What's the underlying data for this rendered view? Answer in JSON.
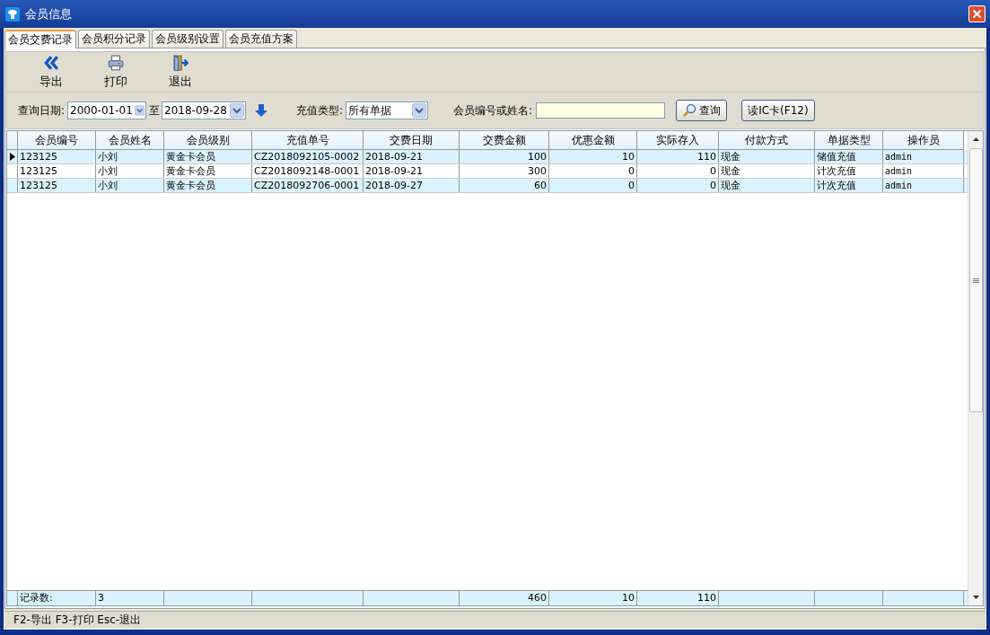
{
  "window": {
    "title": "会员信息"
  },
  "tabs": [
    {
      "label": "会员交费记录",
      "selected": true
    },
    {
      "label": "会员积分记录",
      "selected": false
    },
    {
      "label": "会员级别设置",
      "selected": false
    },
    {
      "label": "会员充值方案",
      "selected": false
    }
  ],
  "toolbar": [
    {
      "kind": "export",
      "label": "导出"
    },
    {
      "kind": "print",
      "label": "打印"
    },
    {
      "kind": "exit",
      "label": "退出"
    }
  ],
  "filters": {
    "date_label": "查询日期:",
    "date_from": "2000-01-01",
    "date_separator": "至",
    "date_to": "2018-09-28",
    "type_label": "充值类型:",
    "type_value": "所有单据",
    "member_label": "会员编号或姓名:",
    "search_button": "查询",
    "ic_button": "读IC卡(F12)"
  },
  "table": {
    "columns": [
      {
        "label": "会员编号",
        "kind": "text"
      },
      {
        "label": "会员姓名",
        "kind": "text"
      },
      {
        "label": "会员级别",
        "kind": "text"
      },
      {
        "label": "充值单号",
        "kind": "text"
      },
      {
        "label": "交费日期",
        "kind": "text"
      },
      {
        "label": "交费金额",
        "kind": "number"
      },
      {
        "label": "优惠金额",
        "kind": "number"
      },
      {
        "label": "实际存入",
        "kind": "number"
      },
      {
        "label": "付款方式",
        "kind": "text"
      },
      {
        "label": "单据类型",
        "kind": "text"
      },
      {
        "label": "操作员",
        "kind": "text"
      }
    ],
    "rows": [
      {
        "selected": true,
        "cells": [
          "123125",
          "小刘",
          "黄金卡会员",
          "CZ2018092105-0002",
          "2018-09-21",
          "100",
          "10",
          "110",
          "现金",
          "储值充值",
          "admin"
        ]
      },
      {
        "selected": false,
        "cells": [
          "123125",
          "小刘",
          "黄金卡会员",
          "CZ2018092148-0001",
          "2018-09-21",
          "300",
          "0",
          "0",
          "现金",
          "计次充值",
          "admin"
        ]
      },
      {
        "selected": false,
        "cells": [
          "123125",
          "小刘",
          "黄金卡会员",
          "CZ2018092706-0001",
          "2018-09-27",
          "60",
          "0",
          "0",
          "现金",
          "计次充值",
          "admin"
        ]
      }
    ],
    "footer": {
      "label": "记录数:",
      "count": "3",
      "totals": [
        "460",
        "10",
        "110"
      ]
    }
  },
  "status_bar": "F2-导出 F3-打印 Esc-退出"
}
